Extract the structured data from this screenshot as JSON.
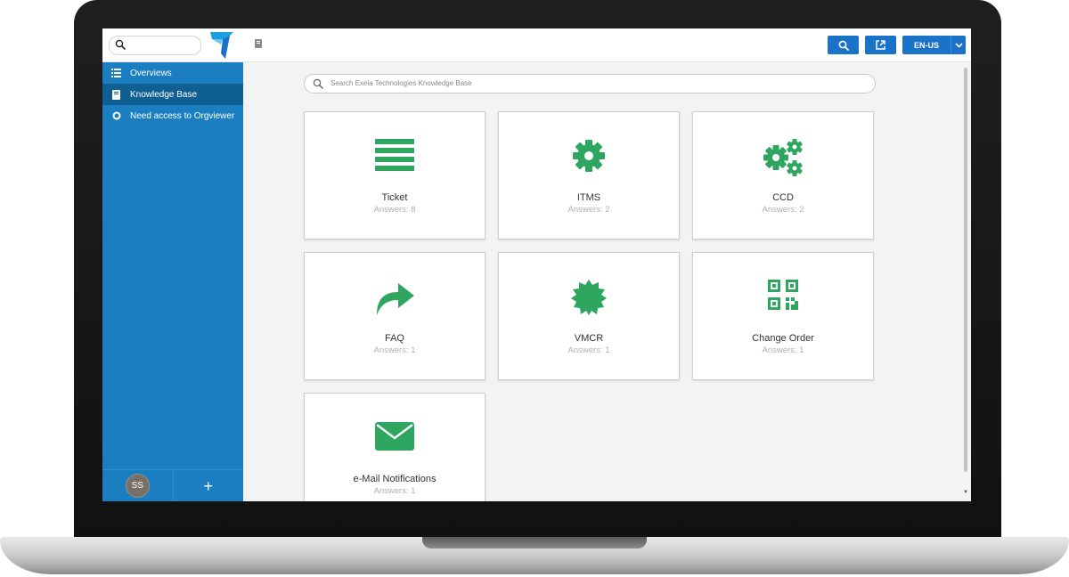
{
  "sidebar": {
    "items": [
      {
        "label": "Overviews",
        "icon": "list-icon"
      },
      {
        "label": "Knowledge Base",
        "icon": "book-icon",
        "active": true
      },
      {
        "label": "Need access to Orgviewer",
        "icon": "circle-icon"
      }
    ],
    "avatar_initials": "SS",
    "add_label": "+"
  },
  "topbar": {
    "language": "EN-US"
  },
  "kb_search": {
    "placeholder": "Search Exela Technologies Knowledge Base"
  },
  "categories": [
    {
      "title": "Ticket",
      "answers": "Answers: 8",
      "icon": "list-icon"
    },
    {
      "title": "ITMS",
      "answers": "Answers: 2",
      "icon": "gear-icon"
    },
    {
      "title": "CCD",
      "answers": "Answers: 2",
      "icon": "gears-icon"
    },
    {
      "title": "FAQ",
      "answers": "Answers: 1",
      "icon": "share-arrow-icon"
    },
    {
      "title": "VMCR",
      "answers": "Answers: 1",
      "icon": "certificate-icon"
    },
    {
      "title": "Change Order",
      "answers": "Answers: 1",
      "icon": "qrcode-icon"
    },
    {
      "title": "e-Mail Notifications",
      "answers": "Answers: 1",
      "icon": "envelope-icon"
    }
  ],
  "colors": {
    "sidebar": "#1a7ec0",
    "sidebar_active": "#0f5f93",
    "button": "#1a73c8",
    "icon_green": "#2ea660"
  }
}
